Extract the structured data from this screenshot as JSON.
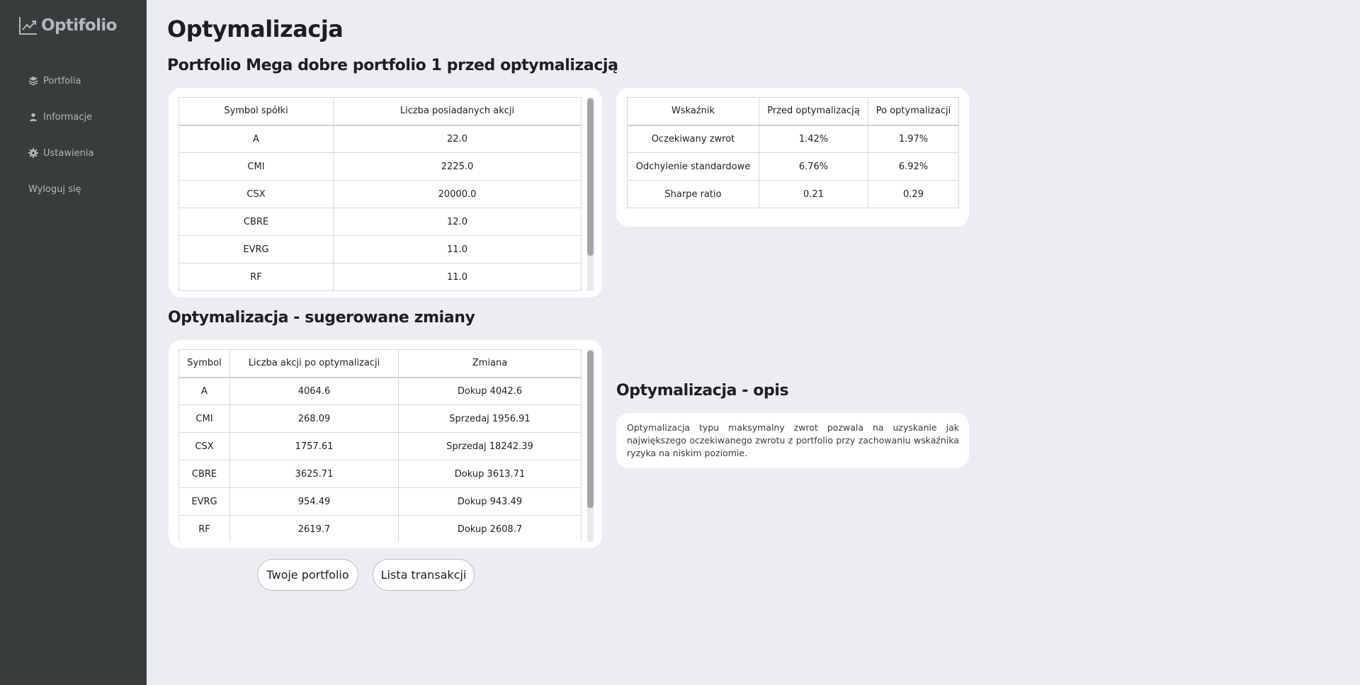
{
  "app": {
    "name": "Optifolio"
  },
  "sidebar": {
    "items": [
      {
        "label": "Portfolia",
        "icon": "layers-icon"
      },
      {
        "label": "Informacje",
        "icon": "user-icon"
      },
      {
        "label": "Ustawienia",
        "icon": "gear-icon"
      },
      {
        "label": "Wyloguj się",
        "icon": ""
      }
    ]
  },
  "page": {
    "title": "Optymalizacja",
    "holdings_title": "Portfolio Mega dobre portfolio 1 przed optymalizacją",
    "changes_title": "Optymalizacja - sugerowane zmiany",
    "description_title": "Optymalizacja - opis"
  },
  "holdings_table": {
    "headers": [
      "Symbol spółki",
      "Liczba posiadanych akcji"
    ],
    "rows": [
      [
        "A",
        "22.0"
      ],
      [
        "CMI",
        "2225.0"
      ],
      [
        "CSX",
        "20000.0"
      ],
      [
        "CBRE",
        "12.0"
      ],
      [
        "EVRG",
        "11.0"
      ],
      [
        "RF",
        "11.0"
      ]
    ]
  },
  "metrics_table": {
    "headers": [
      "Wskaźnik",
      "Przed optymalizacją",
      "Po optymalizacji"
    ],
    "rows": [
      [
        "Oczekiwany zwrot",
        "1.42%",
        "1.97%"
      ],
      [
        "Odchylenie standardowe",
        "6.76%",
        "6.92%"
      ],
      [
        "Sharpe ratio",
        "0.21",
        "0.29"
      ]
    ]
  },
  "changes_table": {
    "headers": [
      "Symbol",
      "Liczba akcji po optymalizacji",
      "Zmiana"
    ],
    "rows": [
      [
        "A",
        "4064.6",
        "Dokup 4042.6"
      ],
      [
        "CMI",
        "268.09",
        "Sprzedaj 1956.91"
      ],
      [
        "CSX",
        "1757.61",
        "Sprzedaj 18242.39"
      ],
      [
        "CBRE",
        "3625.71",
        "Dokup 3613.71"
      ],
      [
        "EVRG",
        "954.49",
        "Dokup 943.49"
      ],
      [
        "RF",
        "2619.7",
        "Dokup 2608.7"
      ]
    ]
  },
  "description": {
    "text": "Optymalizacja typu maksymalny zwrot pozwala na uzyskanie jak największego oczekiwanego zwrotu z portfolio przy zachowaniu wskaźnika ryzyka na niskim poziomie."
  },
  "buttons": {
    "portfolio": "Twoje portfolio",
    "transactions": "Lista transakcji"
  }
}
